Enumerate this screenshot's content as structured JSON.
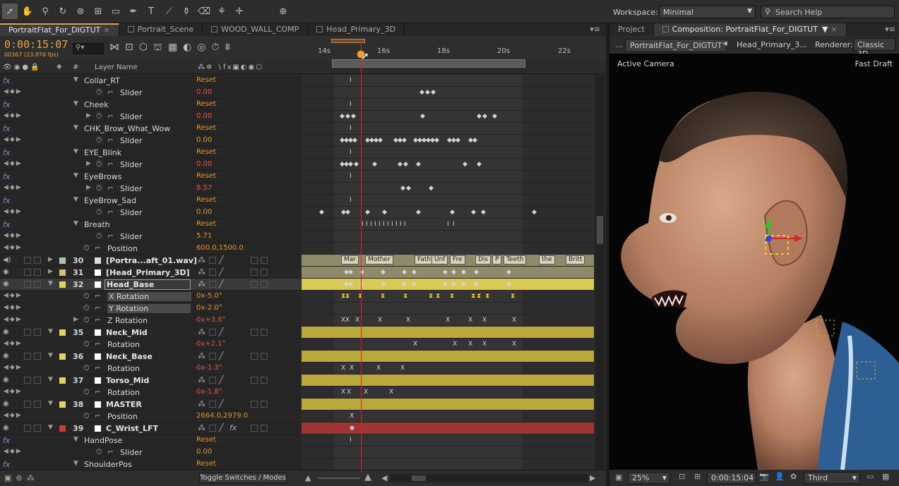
{
  "app": {
    "workspace_label": "Workspace:",
    "workspace_value": "Minimal",
    "search_placeholder": "Search Help"
  },
  "timeline_tabs": [
    {
      "label": "PortraitFlat_For_DIGTUT",
      "active": true
    },
    {
      "label": "Portrait_Scene",
      "active": false
    },
    {
      "label": "WOOD_WALL_COMP",
      "active": false
    },
    {
      "label": "Head_Primary_3D",
      "active": false
    }
  ],
  "timeline": {
    "timecode": "0:00:15:07",
    "frame_fps": "00367 (23.976 fps)",
    "column_layer_name": "Layer Name",
    "column_hash": "#",
    "ruler_labels": [
      "14s",
      "16s",
      "18s",
      "20s",
      "22s"
    ],
    "toggle_label": "Toggle Switches / Modes"
  },
  "layers": [
    {
      "kind": "effect",
      "name": "Collar_RT",
      "value": "Reset"
    },
    {
      "kind": "prop",
      "name": "Slider",
      "value": "0.00",
      "red": true
    },
    {
      "kind": "effect",
      "name": "Cheek",
      "value": "Reset"
    },
    {
      "kind": "prop",
      "name": "Slider",
      "value": "0.00",
      "red": true,
      "twirl": true
    },
    {
      "kind": "effect",
      "name": "CHK_Brow_What_Wow",
      "value": "Reset"
    },
    {
      "kind": "prop",
      "name": "Slider",
      "value": "0.00",
      "red": false
    },
    {
      "kind": "effect",
      "name": "EYE_Blink",
      "value": "Reset"
    },
    {
      "kind": "prop",
      "name": "Slider",
      "value": "0.00",
      "red": true,
      "twirl": true
    },
    {
      "kind": "effect",
      "name": "EyeBrows",
      "value": "Reset"
    },
    {
      "kind": "prop",
      "name": "Slider",
      "value": "8.57",
      "red": true,
      "twirl": true
    },
    {
      "kind": "effect",
      "name": "EyeBrow_Sad",
      "value": "Reset"
    },
    {
      "kind": "prop",
      "name": "Slider",
      "value": "0.00",
      "red": false
    },
    {
      "kind": "effect",
      "name": "Breath",
      "value": "Reset"
    },
    {
      "kind": "prop",
      "name": "Slider",
      "value": "5.71",
      "red": false
    },
    {
      "kind": "prop2",
      "name": "Position",
      "value": "600.0,1500.0"
    },
    {
      "kind": "layer",
      "num": "30",
      "name": "[Portra...aft_01.wav]",
      "color": "#a9c4b4",
      "audio": true
    },
    {
      "kind": "layer",
      "num": "31",
      "name": "[Head_Primary_3D]",
      "color": "#cfc17a"
    },
    {
      "kind": "layer",
      "num": "32",
      "name": "Head_Base",
      "color": "#e3d35a",
      "selected": true
    },
    {
      "kind": "prop2",
      "name": "X Rotation",
      "value": "0x-5.0°",
      "hl": true,
      "gold": true
    },
    {
      "kind": "prop2",
      "name": "Y Rotation",
      "value": "0x-2.0°",
      "hl": true,
      "gold": true
    },
    {
      "kind": "prop2",
      "name": "Z Rotation",
      "value": "0x+3.8°",
      "red": true,
      "twirl": true
    },
    {
      "kind": "layer",
      "num": "35",
      "name": "Neck_Mid",
      "color": "#e3d35a"
    },
    {
      "kind": "prop2",
      "name": "Rotation",
      "value": "0x+2.1°",
      "red": true
    },
    {
      "kind": "layer",
      "num": "36",
      "name": "Neck_Base",
      "color": "#e3d35a"
    },
    {
      "kind": "prop2",
      "name": "Rotation",
      "value": "0x-1.3°",
      "red": true
    },
    {
      "kind": "layer",
      "num": "37",
      "name": "Torso_Mid",
      "color": "#e3d35a"
    },
    {
      "kind": "prop2",
      "name": "Rotation",
      "value": "0x-1.8°",
      "red": true
    },
    {
      "kind": "layer",
      "num": "38",
      "name": "MASTER",
      "color": "#e3d35a"
    },
    {
      "kind": "prop2",
      "name": "Position",
      "value": "2664.0,2979.0"
    },
    {
      "kind": "layer",
      "num": "39",
      "name": "C_Wrist_LFT",
      "color": "#d23a3a",
      "fxlayer": true
    },
    {
      "kind": "effect",
      "name": "HandPose",
      "value": "Reset"
    },
    {
      "kind": "prop",
      "name": "Slider",
      "value": "0.00",
      "red": false
    },
    {
      "kind": "effect",
      "name": "ShoulderPos",
      "value": "Reset"
    }
  ],
  "audio_markers": [
    "Mar",
    "Mother",
    "Fath",
    "Unf",
    "Fre",
    "Dis",
    "P",
    "Teeth",
    "the",
    "Britt"
  ],
  "comp_panel": {
    "tabs": [
      {
        "label": "Project"
      },
      {
        "label": "Composition: PortraitFlat_For_DIGTUT"
      }
    ],
    "crumbs": [
      "PortraitFlat_For_DIGTUT",
      "Head_Primary_3..."
    ],
    "renderer_label": "Renderer:",
    "renderer_value": "Classic 3D",
    "camera": "Active Camera",
    "quality": "Fast Draft",
    "zoom": "25%",
    "timecode": "0:00:15:04",
    "resolution": "Third"
  }
}
